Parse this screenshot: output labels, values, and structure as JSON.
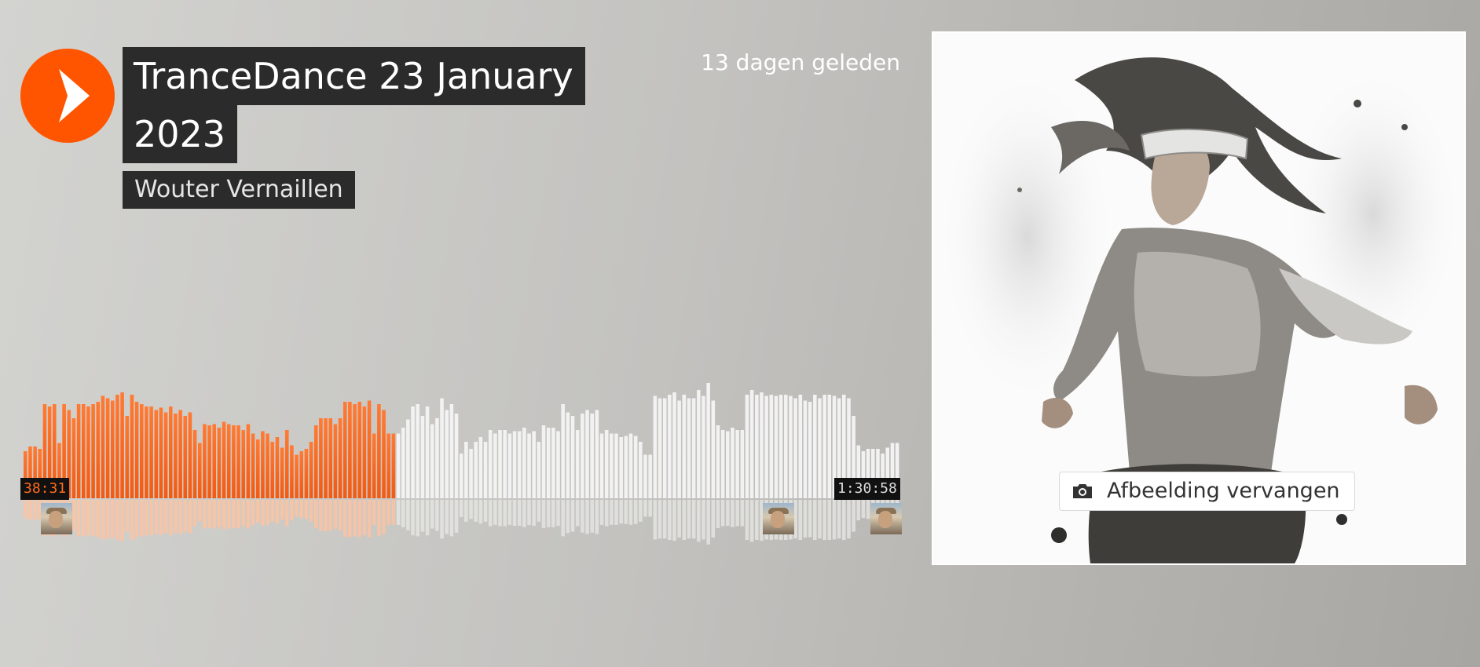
{
  "track": {
    "title_line1": "TranceDance 23 January",
    "title_line2": "2023",
    "artist": "Wouter Vernaillen",
    "posted": "13 dagen geleden"
  },
  "player": {
    "current_time": "38:31",
    "total_time": "1:30:58",
    "progress": 0.4235,
    "played_color": "#ff5500",
    "unplayed_color": "#f2f2f2",
    "waveform_levels": [
      0.4,
      0.44,
      0.44,
      0.42,
      0.8,
      0.78,
      0.8,
      0.47,
      0.8,
      0.75,
      0.68,
      0.8,
      0.8,
      0.78,
      0.8,
      0.82,
      0.87,
      0.85,
      0.83,
      0.88,
      0.9,
      0.7,
      0.88,
      0.82,
      0.8,
      0.78,
      0.78,
      0.75,
      0.77,
      0.73,
      0.78,
      0.72,
      0.75,
      0.7,
      0.73,
      0.58,
      0.47,
      0.63,
      0.62,
      0.63,
      0.6,
      0.65,
      0.63,
      0.62,
      0.62,
      0.58,
      0.63,
      0.55,
      0.5,
      0.57,
      0.55,
      0.48,
      0.52,
      0.43,
      0.58,
      0.45,
      0.37,
      0.4,
      0.42,
      0.48,
      0.62,
      0.68,
      0.68,
      0.68,
      0.63,
      0.68,
      0.82,
      0.82,
      0.8,
      0.82,
      0.78,
      0.83,
      0.55,
      0.8,
      0.75,
      0.55,
      0.55,
      0.55,
      0.6,
      0.67,
      0.78,
      0.8,
      0.7,
      0.78,
      0.63,
      0.68,
      0.85,
      0.75,
      0.8,
      0.72,
      0.38,
      0.48,
      0.42,
      0.48,
      0.52,
      0.48,
      0.58,
      0.55,
      0.58,
      0.58,
      0.55,
      0.57,
      0.57,
      0.6,
      0.55,
      0.57,
      0.48,
      0.62,
      0.6,
      0.6,
      0.57,
      0.8,
      0.73,
      0.7,
      0.58,
      0.72,
      0.75,
      0.72,
      0.75,
      0.55,
      0.58,
      0.55,
      0.55,
      0.52,
      0.53,
      0.55,
      0.53,
      0.48,
      0.37,
      0.37,
      0.87,
      0.85,
      0.85,
      0.88,
      0.9,
      0.83,
      0.88,
      0.85,
      0.85,
      0.92,
      0.87,
      0.98,
      0.83,
      0.62,
      0.58,
      0.57,
      0.6,
      0.58,
      0.58,
      0.88,
      0.92,
      0.88,
      0.9,
      0.87,
      0.88,
      0.87,
      0.88,
      0.88,
      0.87,
      0.85,
      0.88,
      0.83,
      0.82,
      0.88,
      0.85,
      0.88,
      0.88,
      0.87,
      0.85,
      0.88,
      0.85,
      0.7,
      0.45,
      0.4,
      0.42,
      0.42,
      0.42,
      0.38,
      0.43,
      0.47,
      0.47
    ]
  },
  "comments": [
    {
      "name": "comment-avatar-1",
      "at": 0.02
    },
    {
      "name": "comment-avatar-2",
      "at": 0.843
    },
    {
      "name": "comment-avatar-3",
      "at": 0.966
    }
  ],
  "artwork": {
    "replace_label": "Afbeelding vervangen"
  },
  "icons": {
    "play": "play-icon",
    "camera": "camera-icon"
  }
}
